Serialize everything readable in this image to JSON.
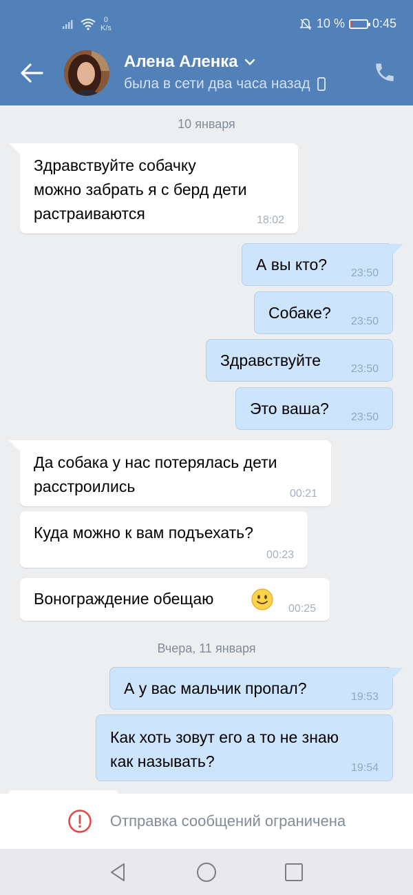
{
  "status_bar": {
    "speed_value": "0",
    "speed_unit": "K/s",
    "battery_percent": "10 %",
    "battery_level": 0.1,
    "time": "0:45"
  },
  "header": {
    "contact_name": "Алена Аленка",
    "last_seen": "была в сети два часа назад",
    "icons": [
      "back-arrow-icon",
      "chevron-down-icon",
      "mobile-icon",
      "phone-icon"
    ],
    "accent_color": "#5181b8"
  },
  "chat": {
    "date_1": "10 января",
    "date_2": "Вчера, 11 января",
    "messages": [
      {
        "dir": "in",
        "text": "Здравствуйте собачку\nможно забрать я с берд дети\nрастраиваются",
        "time": "18:02"
      },
      {
        "dir": "out",
        "text": "А вы кто?",
        "time": "23:50"
      },
      {
        "dir": "out",
        "text": "Собаке?",
        "time": "23:50"
      },
      {
        "dir": "out",
        "text": "Здравствуйте",
        "time": "23:50"
      },
      {
        "dir": "out",
        "text": "Это ваша?",
        "time": "23:50"
      },
      {
        "dir": "in",
        "text": "Да собака у нас потерялась дети\nрасстроились",
        "time": "00:21"
      },
      {
        "dir": "in",
        "text": "Куда можно к вам подъехать?",
        "time": "00:23"
      },
      {
        "dir": "in",
        "text": "Вонограждение обещаю",
        "time": "00:25",
        "emoji": "smile-emoji-icon"
      },
      {
        "dir": "out",
        "text": "А у вас мальчик пропал?",
        "time": "19:53"
      },
      {
        "dir": "out",
        "text": "Как хоть зовут его а то не знаю\nкак называть?",
        "time": "19:54"
      }
    ]
  },
  "footer": {
    "restriction_text": "Отправка сообщений ограничена",
    "restriction_icon": "warning-circle-icon",
    "nav_icons": [
      "nav-back-icon",
      "nav-home-icon",
      "nav-recents-icon"
    ]
  }
}
